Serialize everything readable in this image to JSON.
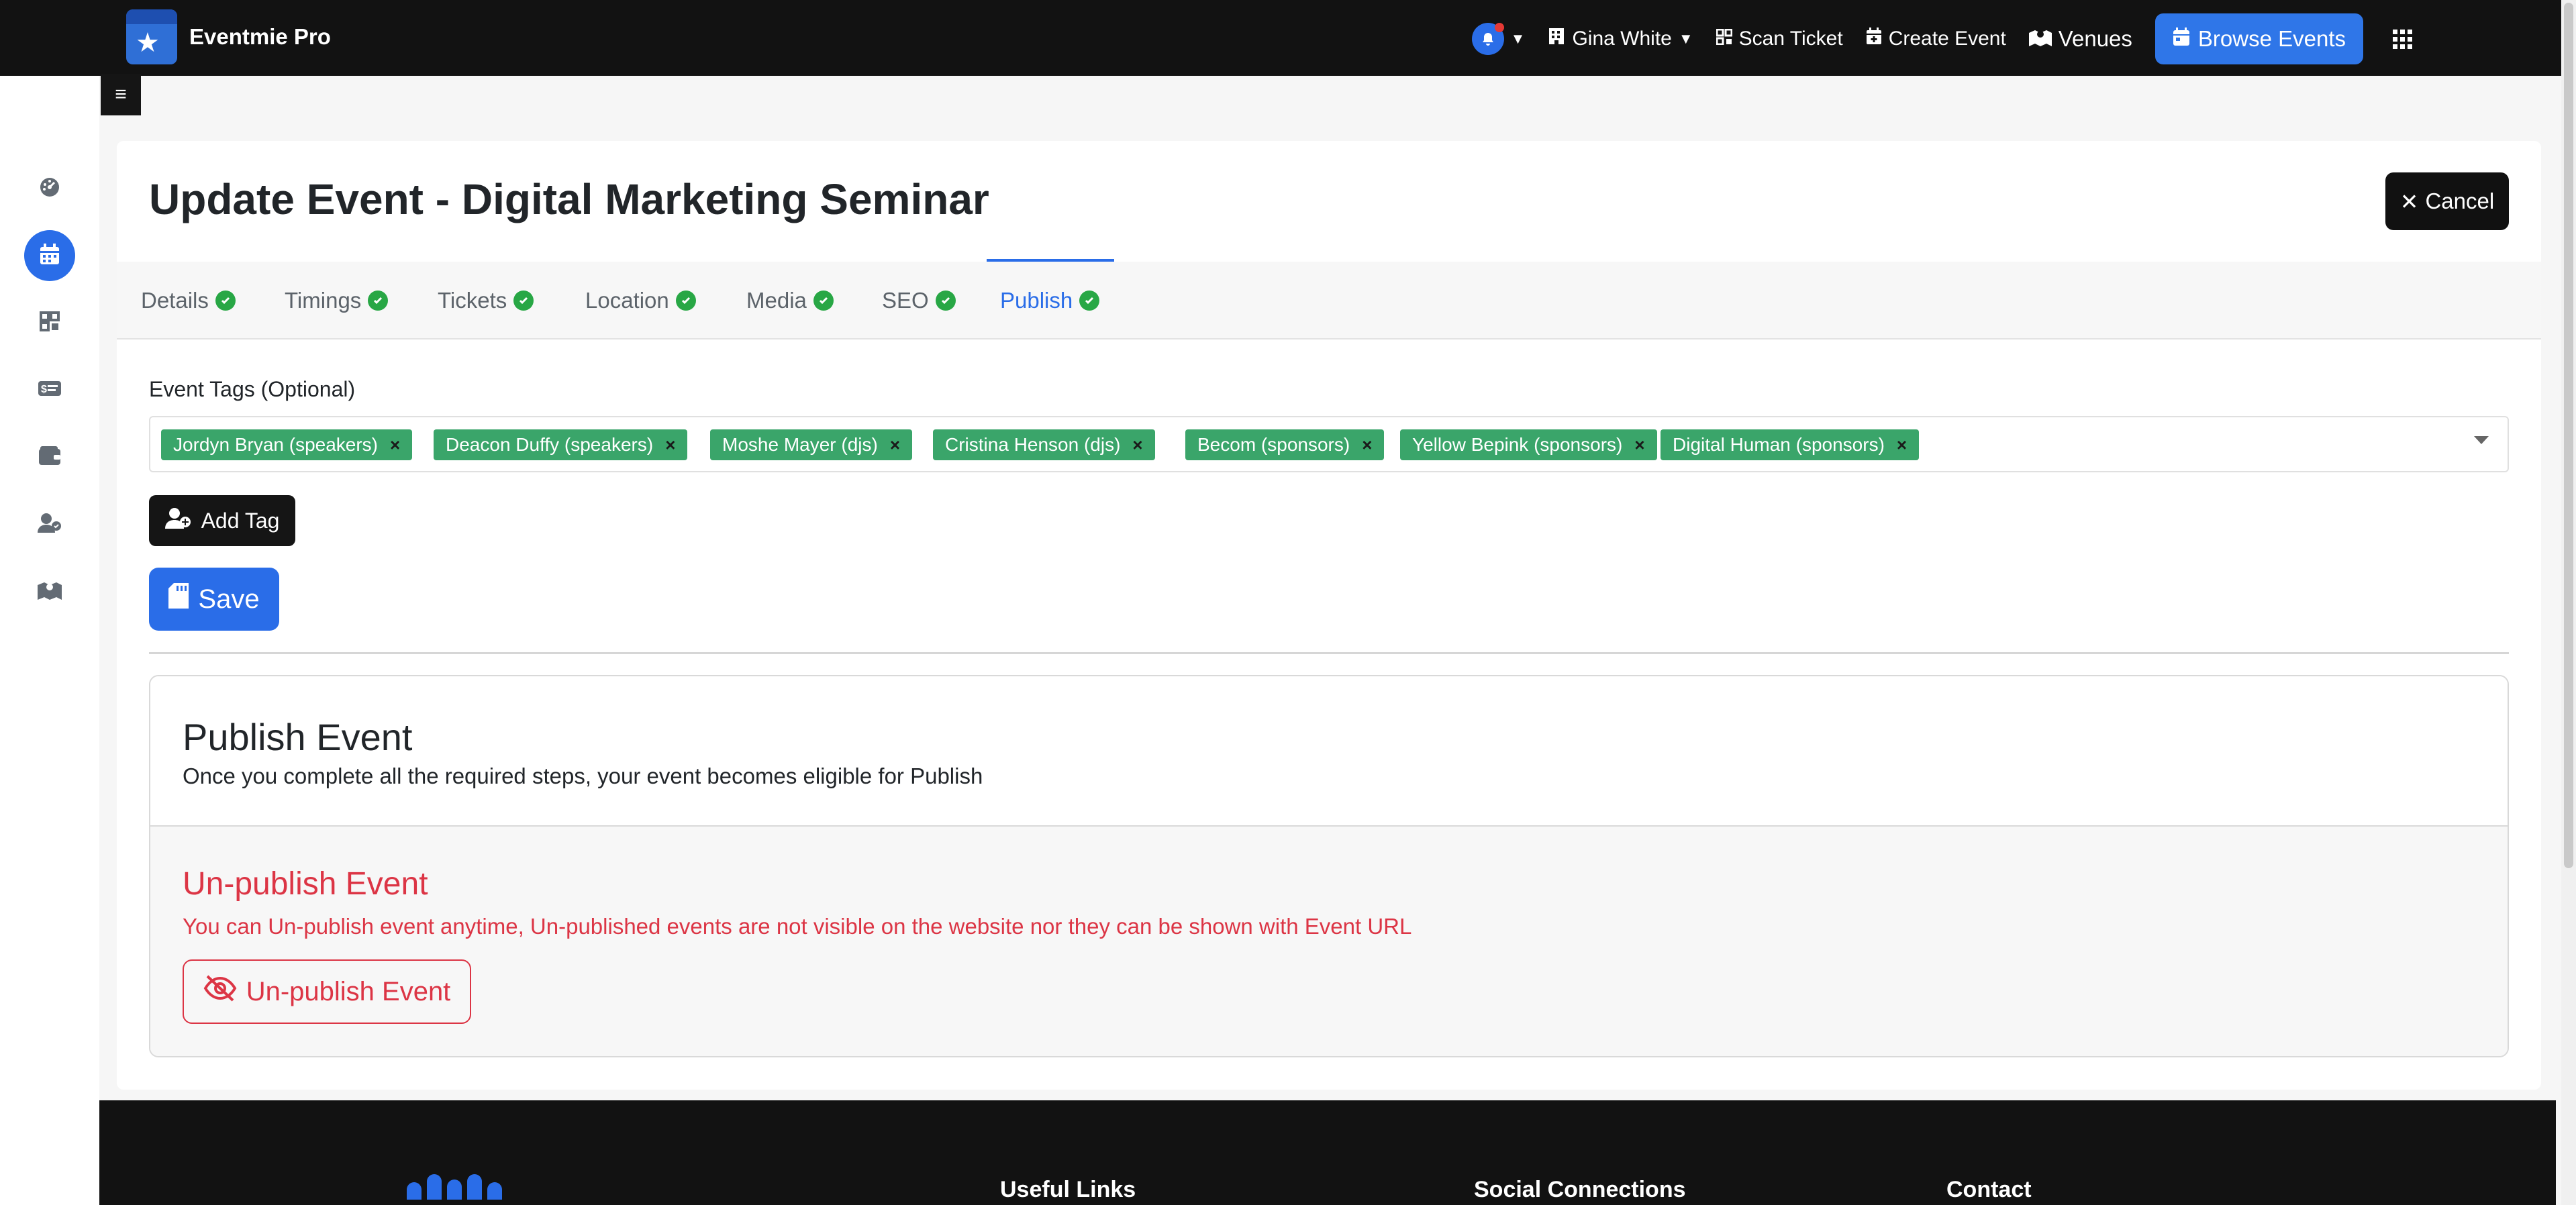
{
  "app": {
    "name": "Eventmie Pro"
  },
  "navbar": {
    "user_name": "Gina White",
    "scan_ticket": "Scan Ticket",
    "create_event": "Create Event",
    "venues": "Venues",
    "browse_events": "Browse Events"
  },
  "sidebar": {
    "items": [
      {
        "name": "dashboard-icon"
      },
      {
        "name": "calendar-icon",
        "active": true
      },
      {
        "name": "qr-code-icon"
      },
      {
        "name": "ticket-icon"
      },
      {
        "name": "wallet-icon"
      },
      {
        "name": "users-icon"
      },
      {
        "name": "map-icon"
      }
    ]
  },
  "page": {
    "title": "Update Event - Digital Marketing Seminar",
    "cancel_label": "Cancel"
  },
  "tabs": [
    {
      "label": "Details"
    },
    {
      "label": "Timings"
    },
    {
      "label": "Tickets"
    },
    {
      "label": "Location"
    },
    {
      "label": "Media"
    },
    {
      "label": "SEO"
    },
    {
      "label": "Publish",
      "active": true
    }
  ],
  "tags": {
    "label": "Event Tags (Optional)",
    "items": [
      "Jordyn Bryan (speakers)",
      "Deacon Duffy (speakers)",
      "Moshe Mayer (djs)",
      "Cristina Henson (djs)",
      "Becom (sponsors)",
      "Yellow Bepink (sponsors)",
      "Digital Human (sponsors)"
    ],
    "add_label": "Add Tag"
  },
  "save_label": "Save",
  "publish": {
    "title": "Publish Event",
    "subtitle": "Once you complete all the required steps, your event becomes eligible for Publish",
    "unpublish_title": "Un-publish Event",
    "unpublish_text": "You can Un-publish event anytime, Un-published events are not visible on the website nor they can be shown with Event URL",
    "unpublish_button": "Un-publish Event"
  },
  "footer": {
    "useful_links": "Useful Links",
    "social_connections": "Social Connections",
    "contact": "Contact"
  },
  "colors": {
    "primary": "#2a6de8",
    "success": "#28a745",
    "danger": "#dc3545",
    "tag": "#3aa56a",
    "dark": "#121212"
  }
}
